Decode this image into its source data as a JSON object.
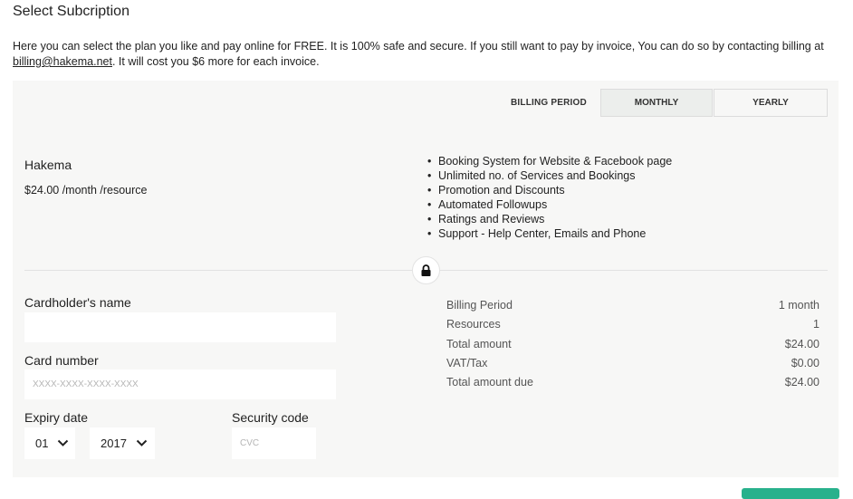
{
  "page_title": "Select Subcription",
  "intro": {
    "text_before": "Here you can select the plan you like and pay online for FREE. It is 100% safe and secure. If you still want to pay by invoice, You can do so by contacting billing at ",
    "email": "billing@hakema.net",
    "text_after": ". It will cost you $6 more for each invoice."
  },
  "billing": {
    "label": "BILLING PERIOD",
    "tabs": [
      {
        "label": "MONTHLY",
        "selected": true
      },
      {
        "label": "YEARLY",
        "selected": false
      }
    ]
  },
  "plan": {
    "name": "Hakema",
    "price": "$24.00 /month /resource",
    "features": [
      "Booking System for Website & Facebook page",
      "Unlimited no. of Services and Bookings",
      "Promotion and Discounts",
      "Automated Followups",
      "Ratings and Reviews",
      "Support - Help Center, Emails and Phone"
    ]
  },
  "form": {
    "cardholder_label": "Cardholder's name",
    "cardholder_value": "",
    "card_number_label": "Card number",
    "card_number_placeholder": "XXXX-XXXX-XXXX-XXXX",
    "expiry_label": "Expiry date",
    "expiry_month": "01",
    "expiry_year": "2017",
    "security_label": "Security code",
    "security_placeholder": "CVC"
  },
  "summary": {
    "rows": [
      {
        "label": "Billing Period",
        "value": "1 month"
      },
      {
        "label": "Resources",
        "value": "1"
      },
      {
        "label": "Total amount",
        "value": "$24.00"
      },
      {
        "label": "VAT/Tax",
        "value": "$0.00"
      },
      {
        "label": "Total amount due",
        "value": "$24.00"
      }
    ]
  },
  "colors": {
    "panel_bg": "#f7f7f6",
    "selected_tab_bg": "#eceeec",
    "button_green": "#28b18c"
  },
  "icons": {
    "lock": "lock-icon",
    "chevron": "chevron-down-icon"
  }
}
